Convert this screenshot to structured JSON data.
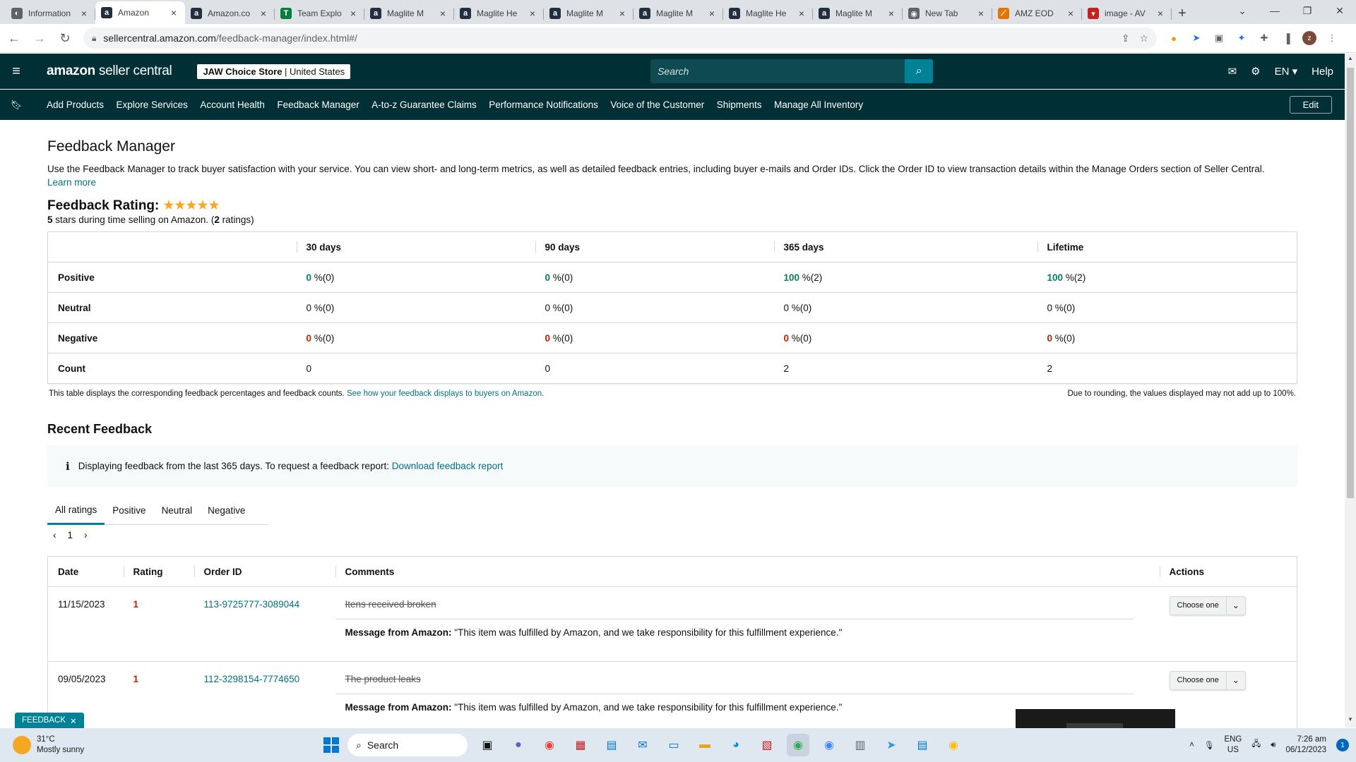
{
  "browser": {
    "tabs": [
      {
        "title": "Information",
        "favicon_color": "#5f6368",
        "favicon": "◐"
      },
      {
        "title": "Amazon",
        "favicon_color": "#232f3e",
        "favicon": "a",
        "active": true
      },
      {
        "title": "Amazon.co",
        "favicon_color": "#232f3e",
        "favicon": "a"
      },
      {
        "title": "Team Explo",
        "favicon_color": "#0a7d3c",
        "favicon": "T"
      },
      {
        "title": "Maglite M",
        "favicon_color": "#232f3e",
        "favicon": "a"
      },
      {
        "title": "Maglite He",
        "favicon_color": "#232f3e",
        "favicon": "a"
      },
      {
        "title": "Maglite M",
        "favicon_color": "#232f3e",
        "favicon": "a"
      },
      {
        "title": "Maglite M",
        "favicon_color": "#232f3e",
        "favicon": "a"
      },
      {
        "title": "Maglite He",
        "favicon_color": "#232f3e",
        "favicon": "a"
      },
      {
        "title": "Maglite M",
        "favicon_color": "#232f3e",
        "favicon": "a"
      },
      {
        "title": "New Tab",
        "favicon_color": "#5f6368",
        "favicon": "◉"
      },
      {
        "title": "AMZ EOD",
        "favicon_color": "#e37400",
        "favicon": "⟋"
      },
      {
        "title": "image - AV",
        "favicon_color": "#c5221f",
        "favicon": "▾"
      }
    ],
    "url_host": "sellercentral.amazon.com",
    "url_path": "/feedback-manager/index.html#/"
  },
  "header": {
    "logo_bold": "amazon",
    "logo_rest": " seller central",
    "store_name": "JAW Choice Store",
    "store_region": "United States",
    "search_placeholder": "Search",
    "language": "EN",
    "help": "Help"
  },
  "nav": {
    "items": [
      "Add Products",
      "Explore Services",
      "Account Health",
      "Feedback Manager",
      "A-to-z Guarantee Claims",
      "Performance Notifications",
      "Voice of the Customer",
      "Shipments",
      "Manage All Inventory"
    ],
    "edit_label": "Edit"
  },
  "page": {
    "title": "Feedback Manager",
    "description": "Use the Feedback Manager to track buyer satisfaction with your service. You can view short- and long-term metrics, as well as detailed feedback entries, including buyer e-mails and Order IDs. Click the Order ID to view transaction details within the Manage Orders section of Seller Central.",
    "learn_more": "Learn more",
    "rating_label": "Feedback Rating:",
    "stars": "★★★★★",
    "rating_stars_value": "5",
    "rating_sub_mid": " stars during time selling on Amazon. (",
    "rating_count": "2",
    "rating_sub_end": " ratings)"
  },
  "metrics": {
    "columns": [
      "30 days",
      "90 days",
      "365 days",
      "Lifetime"
    ],
    "rows": [
      {
        "label": "Positive",
        "cells": [
          {
            "v": "0",
            "c": "(0)"
          },
          {
            "v": "0",
            "c": "(0)"
          },
          {
            "v": "100",
            "c": "(2)"
          },
          {
            "v": "100",
            "c": "(2)"
          }
        ],
        "color": "green"
      },
      {
        "label": "Neutral",
        "cells": [
          {
            "v": "0",
            "c": "(0)"
          },
          {
            "v": "0",
            "c": "(0)"
          },
          {
            "v": "0",
            "c": "(0)"
          },
          {
            "v": "0",
            "c": "(0)"
          }
        ],
        "color": "plain"
      },
      {
        "label": "Negative",
        "cells": [
          {
            "v": "0",
            "c": "(0)"
          },
          {
            "v": "0",
            "c": "(0)"
          },
          {
            "v": "0",
            "c": "(0)"
          },
          {
            "v": "0",
            "c": "(0)"
          }
        ],
        "color": "red"
      }
    ],
    "count_label": "Count",
    "counts": [
      "0",
      "0",
      "2",
      "2"
    ],
    "note": "This table displays the corresponding feedback percentages and feedback counts.",
    "note_link": "See how your feedback displays to buyers on Amazon.",
    "rounding_note": "Due to rounding, the values displayed may not add up to 100%."
  },
  "recent": {
    "title": "Recent Feedback",
    "info": "Displaying feedback from the last 365 days. To request a feedback report:",
    "info_link": "Download feedback report",
    "tabs": [
      "All ratings",
      "Positive",
      "Neutral",
      "Negative"
    ],
    "page": "1",
    "columns": [
      "Date",
      "Rating",
      "Order ID",
      "Comments",
      "Actions"
    ],
    "rows": [
      {
        "date": "11/15/2023",
        "rating": "1",
        "order_id": "113-9725777-3089044",
        "comment": "Itens received broken",
        "msg_label": "Message from Amazon:",
        "msg": " \"This item was fulfilled by Amazon, and we take responsibility for this fulfillment experience.\"",
        "action": "Choose one"
      },
      {
        "date": "09/05/2023",
        "rating": "1",
        "order_id": "112-3298154-7774650",
        "comment": "The product leaks",
        "msg_label": "Message from Amazon:",
        "msg": " \"This item was fulfilled by Amazon, and we take responsibility for this fulfillment experience.\"",
        "action": "Choose one"
      }
    ]
  },
  "feedback_badge": "FEEDBACK",
  "taskbar": {
    "temp": "31°C",
    "weather": "Mostly sunny",
    "search": "Search",
    "lang_top": "ENG",
    "lang_bottom": "US",
    "time": "7:26 am",
    "date": "06/12/2023",
    "notifications": "1"
  }
}
